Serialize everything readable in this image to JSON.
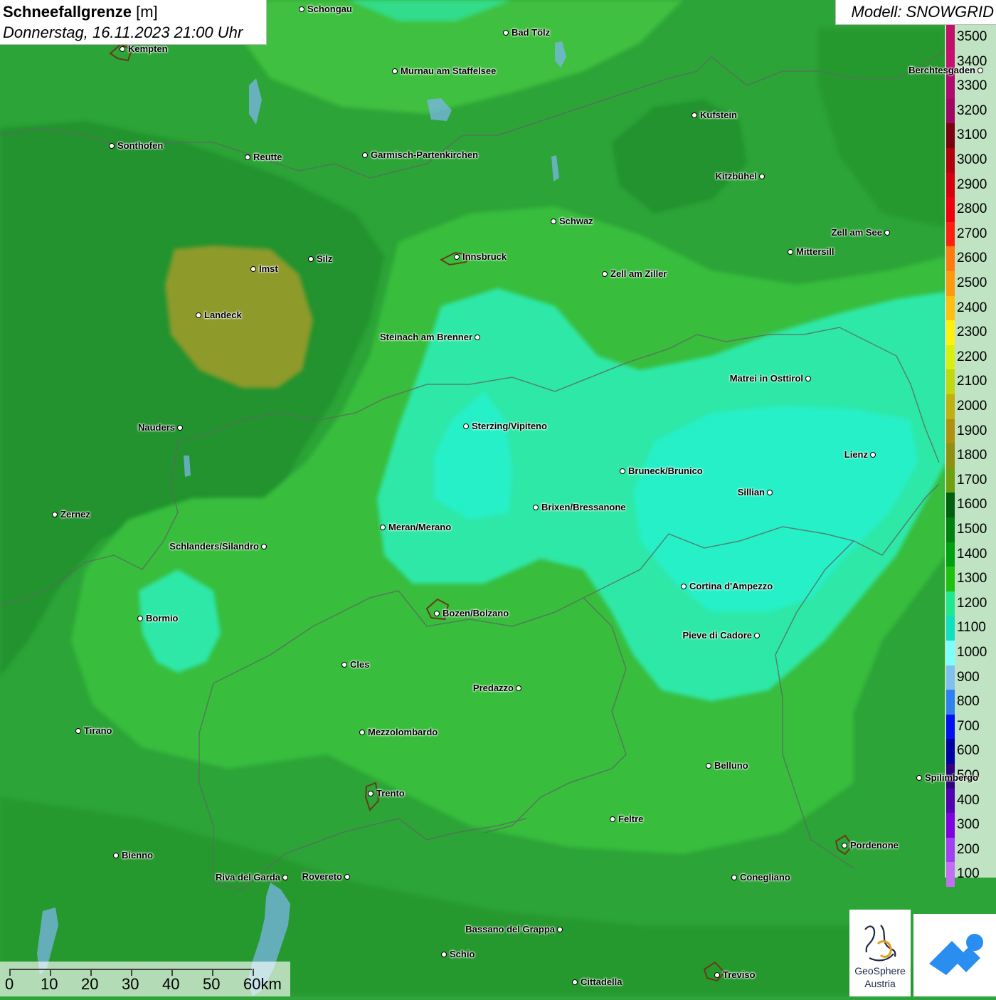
{
  "title": {
    "label": "Schneefallgrenze",
    "unit": "[m]",
    "datetime": "Donnerstag, 16.11.2023 21:00 Uhr"
  },
  "model": "Modell: SNOWGRID",
  "legend": [
    {
      "label": "3500",
      "color": "#c0106a"
    },
    {
      "label": "3400",
      "color": "#c8106e"
    },
    {
      "label": "3300",
      "color": "#b00a70"
    },
    {
      "label": "3200",
      "color": "#a00666"
    },
    {
      "label": "3100",
      "color": "#7a0010"
    },
    {
      "label": "3000",
      "color": "#b00010"
    },
    {
      "label": "2900",
      "color": "#d40010"
    },
    {
      "label": "2800",
      "color": "#ee0010"
    },
    {
      "label": "2700",
      "color": "#ff2010"
    },
    {
      "label": "2600",
      "color": "#ff7a10"
    },
    {
      "label": "2500",
      "color": "#ff9a10"
    },
    {
      "label": "2400",
      "color": "#ffc010"
    },
    {
      "label": "2300",
      "color": "#fff010"
    },
    {
      "label": "2200",
      "color": "#d8f010"
    },
    {
      "label": "2100",
      "color": "#c0d810"
    },
    {
      "label": "2000",
      "color": "#c0b010"
    },
    {
      "label": "1900",
      "color": "#b09010"
    },
    {
      "label": "1800",
      "color": "#909010"
    },
    {
      "label": "1700",
      "color": "#70a010"
    },
    {
      "label": "1600",
      "color": "#006010"
    },
    {
      "label": "1500",
      "color": "#008010"
    },
    {
      "label": "1400",
      "color": "#00a010"
    },
    {
      "label": "1300",
      "color": "#20c010"
    },
    {
      "label": "1200",
      "color": "#20e890"
    },
    {
      "label": "1100",
      "color": "#10e0c0"
    },
    {
      "label": "1000",
      "color": "#80ffff"
    },
    {
      "label": "900",
      "color": "#80c0f0"
    },
    {
      "label": "800",
      "color": "#3080f0"
    },
    {
      "label": "700",
      "color": "#0010f0"
    },
    {
      "label": "600",
      "color": "#0000a0"
    },
    {
      "label": "500",
      "color": "#300080"
    },
    {
      "label": "400",
      "color": "#5000b0"
    },
    {
      "label": "300",
      "color": "#8000e0"
    },
    {
      "label": "200",
      "color": "#a040f0"
    },
    {
      "label": "100",
      "color": "#c070f0"
    }
  ],
  "cities": [
    {
      "name": "Schongau",
      "side": "right"
    },
    {
      "name": "Bad Tölz",
      "side": "right"
    },
    {
      "name": "Kempten",
      "side": "right"
    },
    {
      "name": "Murnau am Staffelsee",
      "side": "right"
    },
    {
      "name": "Berchtesgaden",
      "side": "left"
    },
    {
      "name": "Kufstein",
      "side": "right"
    },
    {
      "name": "Sonthofen",
      "side": "right"
    },
    {
      "name": "Reutte",
      "side": "right"
    },
    {
      "name": "Garmisch-Partenkirchen",
      "side": "right"
    },
    {
      "name": "Kitzbühel",
      "side": "left"
    },
    {
      "name": "Schwaz",
      "side": "right"
    },
    {
      "name": "Zell am See",
      "side": "left"
    },
    {
      "name": "Mittersill",
      "side": "right"
    },
    {
      "name": "Innsbruck",
      "side": "right"
    },
    {
      "name": "Silz",
      "side": "right"
    },
    {
      "name": "Imst",
      "side": "right"
    },
    {
      "name": "Zell am Ziller",
      "side": "right"
    },
    {
      "name": "Landeck",
      "side": "right"
    },
    {
      "name": "Steinach am Brenner",
      "side": "left"
    },
    {
      "name": "Matrei in Osttirol",
      "side": "left"
    },
    {
      "name": "Nauders",
      "side": "left"
    },
    {
      "name": "Sterzing/Vipiteno",
      "side": "right"
    },
    {
      "name": "Lienz",
      "side": "left"
    },
    {
      "name": "Bruneck/Brunico",
      "side": "right"
    },
    {
      "name": "Sillian",
      "side": "left"
    },
    {
      "name": "Brixen/Bressanone",
      "side": "right"
    },
    {
      "name": "Zernez",
      "side": "right"
    },
    {
      "name": "Meran/Merano",
      "side": "right"
    },
    {
      "name": "Schlanders/Silandro",
      "side": "left"
    },
    {
      "name": "Cortina d'Ampezzo",
      "side": "right"
    },
    {
      "name": "Bozen/Bolzano",
      "side": "right"
    },
    {
      "name": "Bormio",
      "side": "right"
    },
    {
      "name": "Pieve di Cadore",
      "side": "left"
    },
    {
      "name": "Cles",
      "side": "right"
    },
    {
      "name": "Predazzo",
      "side": "left"
    },
    {
      "name": "Tirano",
      "side": "right"
    },
    {
      "name": "Mezzolombardo",
      "side": "right"
    },
    {
      "name": "Belluno",
      "side": "right"
    },
    {
      "name": "Spilimbergo",
      "side": "right"
    },
    {
      "name": "Trento",
      "side": "right"
    },
    {
      "name": "Feltre",
      "side": "right"
    },
    {
      "name": "Pordenone",
      "side": "right"
    },
    {
      "name": "Bienno",
      "side": "right"
    },
    {
      "name": "Riva del Garda",
      "side": "left"
    },
    {
      "name": "Rovereto",
      "side": "left"
    },
    {
      "name": "Conegliano",
      "side": "right"
    },
    {
      "name": "Bassano del Grappa",
      "side": "left"
    },
    {
      "name": "Schio",
      "side": "right"
    },
    {
      "name": "Treviso",
      "side": "right"
    },
    {
      "name": "Cittadella",
      "side": "right"
    }
  ],
  "scale": {
    "labels": [
      "0",
      "10",
      "20",
      "30",
      "40",
      "50",
      "60km"
    ]
  },
  "logos": {
    "geosphere_line1": "GeoSphere",
    "geosphere_line2": "Austria"
  }
}
